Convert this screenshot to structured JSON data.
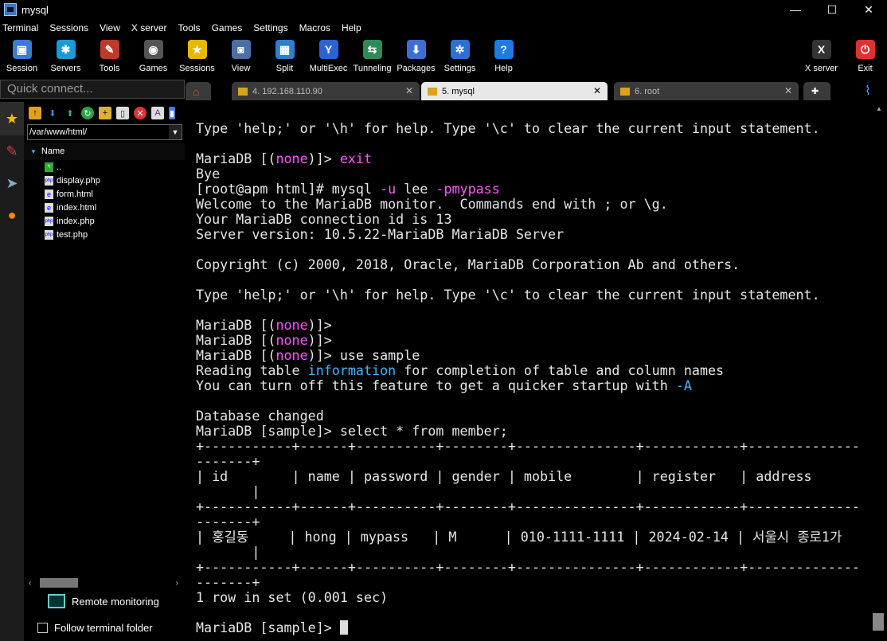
{
  "window": {
    "title": "mysql",
    "min": "—",
    "max": "☐",
    "close": "✕"
  },
  "menu": [
    "Terminal",
    "Sessions",
    "View",
    "X server",
    "Tools",
    "Games",
    "Settings",
    "Macros",
    "Help"
  ],
  "toolbar": {
    "left": [
      {
        "label": "Session",
        "icon": "session-icon",
        "color": "#3a7bd5",
        "glyph": "▣"
      },
      {
        "label": "Servers",
        "icon": "servers-icon",
        "color": "#1b9ad6",
        "glyph": "✱"
      },
      {
        "label": "Tools",
        "icon": "tools-icon",
        "color": "#c0392b",
        "glyph": "✎"
      },
      {
        "label": "Games",
        "icon": "games-icon",
        "color": "#555",
        "glyph": "◉"
      },
      {
        "label": "Sessions",
        "icon": "star-icon",
        "color": "#e6b800",
        "glyph": "★"
      },
      {
        "label": "View",
        "icon": "view-icon",
        "color": "#4a6fa5",
        "glyph": "◙"
      },
      {
        "label": "Split",
        "icon": "split-icon",
        "color": "#2f7fd1",
        "glyph": "▦"
      },
      {
        "label": "MultiExec",
        "icon": "multiexec-icon",
        "color": "#2b63d4",
        "glyph": "Y"
      },
      {
        "label": "Tunneling",
        "icon": "tunneling-icon",
        "color": "#2e8b57",
        "glyph": "⇆"
      },
      {
        "label": "Packages",
        "icon": "packages-icon",
        "color": "#3c6fd6",
        "glyph": "⬇"
      },
      {
        "label": "Settings",
        "icon": "settings-icon",
        "color": "#2d6fd6",
        "glyph": "✲"
      },
      {
        "label": "Help",
        "icon": "help-icon",
        "color": "#1e7be0",
        "glyph": "?"
      }
    ],
    "right": [
      {
        "label": "X server",
        "icon": "xserver-icon",
        "color": "#333",
        "glyph": "X"
      },
      {
        "label": "Exit",
        "icon": "exit-icon",
        "color": "#e03030",
        "glyph": "⏻"
      }
    ]
  },
  "quick_connect": {
    "placeholder": "Quick connect..."
  },
  "tabs": [
    {
      "label": "4. 192.168.110.90"
    },
    {
      "label": "5. mysql"
    },
    {
      "label": "6. root"
    }
  ],
  "filebrowser": {
    "path": "/var/www/html/",
    "column": "Name",
    "files": [
      {
        "name": ".."
      },
      {
        "name": "display.php"
      },
      {
        "name": "form.html"
      },
      {
        "name": "index.html"
      },
      {
        "name": "index.php"
      },
      {
        "name": "test.php"
      }
    ]
  },
  "remote_monitoring": "Remote monitoring",
  "follow_terminal": "Follow terminal folder",
  "terminal": {
    "lines": [
      [
        [
          "",
          "Type 'help;' or '\\h' for help. Type '\\c' to clear the current input statement."
        ]
      ],
      [
        [
          "",
          ""
        ]
      ],
      [
        [
          "",
          "MariaDB [("
        ],
        [
          "mg",
          "none"
        ],
        [
          "",
          ")]> "
        ],
        [
          "mg",
          "exit"
        ]
      ],
      [
        [
          "",
          "Bye"
        ]
      ],
      [
        [
          "",
          "[root@apm html]# mysql "
        ],
        [
          "mg",
          "-u"
        ],
        [
          "",
          " lee "
        ],
        [
          "mg",
          "-pmypass"
        ]
      ],
      [
        [
          "",
          "Welcome to the MariaDB monitor.  Commands end with ; or \\g."
        ]
      ],
      [
        [
          "",
          "Your MariaDB connection id is 13"
        ]
      ],
      [
        [
          "",
          "Server version: 10.5.22-MariaDB MariaDB Server"
        ]
      ],
      [
        [
          "",
          ""
        ]
      ],
      [
        [
          "",
          "Copyright (c) 2000, 2018, Oracle, MariaDB Corporation Ab and others."
        ]
      ],
      [
        [
          "",
          ""
        ]
      ],
      [
        [
          "",
          "Type 'help;' or '\\h' for help. Type '\\c' to clear the current input statement."
        ]
      ],
      [
        [
          "",
          ""
        ]
      ],
      [
        [
          "",
          "MariaDB [("
        ],
        [
          "mg",
          "none"
        ],
        [
          "",
          ")]>"
        ]
      ],
      [
        [
          "",
          "MariaDB [("
        ],
        [
          "mg",
          "none"
        ],
        [
          "",
          ")]>"
        ]
      ],
      [
        [
          "",
          "MariaDB [("
        ],
        [
          "mg",
          "none"
        ],
        [
          "",
          ")]> use sample"
        ]
      ],
      [
        [
          "",
          "Reading table "
        ],
        [
          "cy",
          "information"
        ],
        [
          "",
          " for completion of table and column names"
        ]
      ],
      [
        [
          "",
          "You can turn off this feature to get a quicker startup with "
        ],
        [
          "cy",
          "-A"
        ]
      ],
      [
        [
          "",
          ""
        ]
      ],
      [
        [
          "",
          "Database changed"
        ]
      ],
      [
        [
          "",
          "MariaDB [sample]> select * from member;"
        ]
      ],
      [
        [
          "",
          "+-----------+------+----------+--------+---------------+------------+--------------"
        ]
      ],
      [
        [
          "",
          "-------+"
        ]
      ],
      [
        [
          "",
          "| id        | name | password | gender | mobile        | register   | address"
        ]
      ],
      [
        [
          "",
          "       |"
        ]
      ],
      [
        [
          "",
          "+-----------+------+----------+--------+---------------+------------+--------------"
        ]
      ],
      [
        [
          "",
          "-------+"
        ]
      ],
      [
        [
          "",
          "| 홍길동     | hong | mypass   | M      | 010-1111-1111 | 2024-02-14 | 서울시 종로1가"
        ]
      ],
      [
        [
          "",
          "       |"
        ]
      ],
      [
        [
          "",
          "+-----------+------+----------+--------+---------------+------------+--------------"
        ]
      ],
      [
        [
          "",
          "-------+"
        ]
      ],
      [
        [
          "",
          "1 row in set (0.001 sec)"
        ]
      ],
      [
        [
          "",
          ""
        ]
      ],
      [
        [
          "",
          "MariaDB [sample]> "
        ]
      ]
    ]
  }
}
